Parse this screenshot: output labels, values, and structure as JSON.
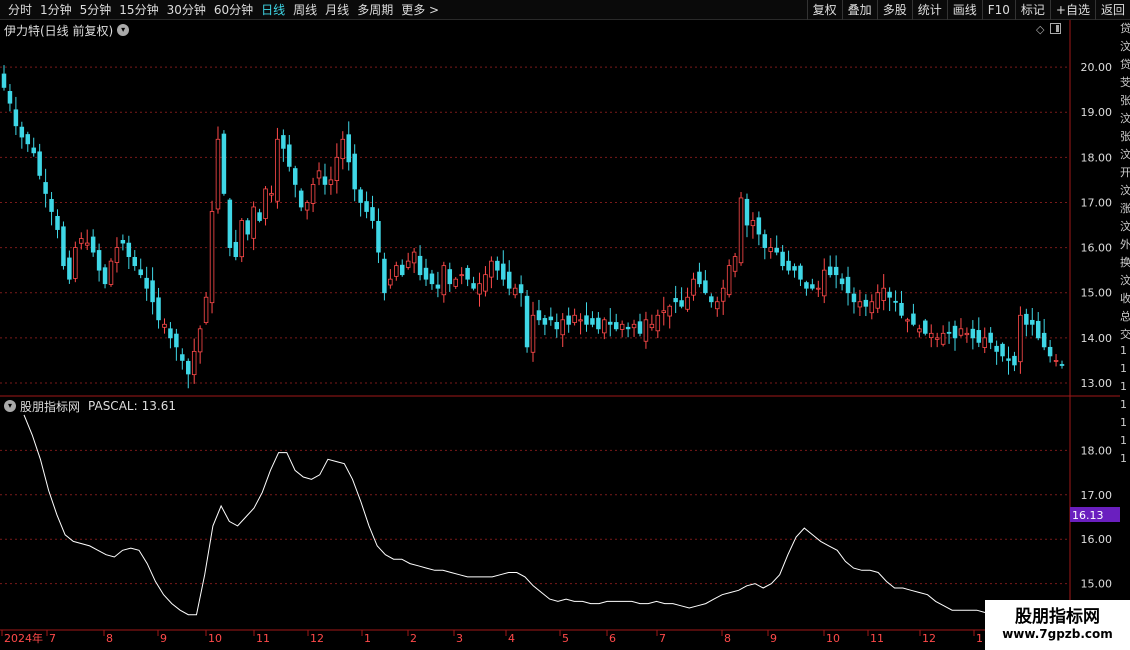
{
  "toolbar": {
    "period_tabs": [
      "分时",
      "1分钟",
      "5分钟",
      "15分钟",
      "30分钟",
      "60分钟",
      "日线",
      "周线",
      "月线",
      "多周期",
      "更多 >"
    ],
    "active_tab": "日线",
    "right_buttons": [
      "复权",
      "叠加",
      "多股",
      "统计",
      "画线",
      "F10",
      "标记",
      "+自选",
      "返回"
    ]
  },
  "main_chart": {
    "title": "伊力特(日线 前复权)",
    "price_ticks": [
      "20.00",
      "19.00",
      "18.00",
      "17.00",
      "16.00",
      "15.00",
      "14.00",
      "13.00"
    ]
  },
  "indicator": {
    "title": "股朋指标网",
    "label": "PASCAL:",
    "value": "13.61",
    "ticks": [
      "18.00",
      "17.00",
      "16.00",
      "15.00"
    ],
    "cursor_value": "16.13",
    "cursor_color": "#6a1fbf"
  },
  "date_axis": {
    "labels": [
      "2024年",
      "7",
      "8",
      "9",
      "10",
      "11",
      "12",
      "1",
      "2",
      "3",
      "4",
      "5",
      "6",
      "7",
      "8",
      "9",
      "10",
      "11",
      "12",
      "1"
    ]
  },
  "right_edge_chars": [
    "贷",
    "汶",
    "贷",
    "芠",
    "张",
    "汶",
    "张",
    "汶",
    "开",
    "汶",
    "涨",
    "汶",
    "外",
    "换",
    "汶",
    "收",
    "总",
    "交",
    "1",
    "1",
    "1",
    "1",
    "1",
    "1",
    "1"
  ],
  "watermark": {
    "title": "股朋指标网",
    "url": "www.7gpzb.com"
  },
  "colors": {
    "up": "#ff4a4a",
    "down": "#3fd7e6",
    "grid": "#7a1a1a",
    "axis": "#a01818",
    "line": "#ffffff"
  },
  "chart_data": [
    {
      "type": "candlestick",
      "title": "伊力特(日线 前复权)",
      "ylim": [
        12.8,
        20.6
      ],
      "y_ticks": [
        20,
        19,
        18,
        17,
        16,
        15,
        14,
        13
      ],
      "x_labels": [
        "2024年",
        "7",
        "8",
        "9",
        "10",
        "11",
        "12",
        "1",
        "2",
        "3",
        "4",
        "5",
        "6",
        "7",
        "8",
        "9",
        "10",
        "11",
        "12",
        "1"
      ],
      "close": [
        19.55,
        19.2,
        18.7,
        18.45,
        18.3,
        18.1,
        17.6,
        17.2,
        16.8,
        16.4,
        15.6,
        15.3,
        16.0,
        16.2,
        16.1,
        15.9,
        15.5,
        15.2,
        15.7,
        16.0,
        16.1,
        15.8,
        15.6,
        15.4,
        15.1,
        14.8,
        14.4,
        14.3,
        14.0,
        13.8,
        13.5,
        13.2,
        13.7,
        14.2,
        14.9,
        16.8,
        18.4,
        17.2,
        16.0,
        15.8,
        16.6,
        16.3,
        16.9,
        16.6,
        17.3,
        17.2,
        18.4,
        18.2,
        17.8,
        17.4,
        16.9,
        17.0,
        17.4,
        17.7,
        17.4,
        17.5,
        18.0,
        18.4,
        17.9,
        17.3,
        17.0,
        16.8,
        16.6,
        15.9,
        15.0,
        15.3,
        15.6,
        15.4,
        15.7,
        15.9,
        15.4,
        15.3,
        15.2,
        15.1,
        15.6,
        15.2,
        15.3,
        15.4,
        15.3,
        15.1,
        15.2,
        15.4,
        15.7,
        15.5,
        15.3,
        15.1,
        15.1,
        15.0,
        13.8,
        14.5,
        14.4,
        14.3,
        14.4,
        14.2,
        14.4,
        14.3,
        14.5,
        14.4,
        14.3,
        14.3,
        14.2,
        14.4,
        14.3,
        14.2,
        14.3,
        14.2,
        14.3,
        14.1,
        14.4,
        14.3,
        14.5,
        14.6,
        14.7,
        14.8,
        14.7,
        14.9,
        15.3,
        15.2,
        15.0,
        14.8,
        14.8,
        15.1,
        15.6,
        15.8,
        17.1,
        16.5,
        16.6,
        16.3,
        16.0,
        16.0,
        15.9,
        15.6,
        15.5,
        15.5,
        15.3,
        15.1,
        15.1,
        15.1,
        15.5,
        15.4,
        15.4,
        15.2,
        15.0,
        14.8,
        14.8,
        14.7,
        14.8,
        15.0,
        15.1,
        14.9,
        14.8,
        14.5,
        14.4,
        14.3,
        14.2,
        14.1,
        14.1,
        14.0,
        14.1,
        14.1,
        14.0,
        14.2,
        14.1,
        14.0,
        13.9,
        14.0,
        13.9,
        13.7,
        13.6,
        13.5,
        13.4,
        14.5,
        14.3,
        14.3,
        14.0,
        13.8,
        13.6,
        13.5,
        13.4
      ]
    },
    {
      "type": "line",
      "name": "PASCAL",
      "ylim": [
        14.0,
        19.0
      ],
      "y_ticks": [
        18,
        17,
        16,
        15
      ],
      "values": [
        18.8,
        18.35,
        17.8,
        17.1,
        16.55,
        16.1,
        15.95,
        15.9,
        15.85,
        15.75,
        15.65,
        15.6,
        15.75,
        15.8,
        15.75,
        15.45,
        15.05,
        14.75,
        14.55,
        14.4,
        14.3,
        14.3,
        15.2,
        16.3,
        16.75,
        16.4,
        16.3,
        16.5,
        16.7,
        17.05,
        17.55,
        17.95,
        17.95,
        17.55,
        17.4,
        17.35,
        17.45,
        17.8,
        17.75,
        17.7,
        17.35,
        16.85,
        16.3,
        15.85,
        15.65,
        15.55,
        15.55,
        15.45,
        15.4,
        15.35,
        15.3,
        15.3,
        15.25,
        15.2,
        15.15,
        15.15,
        15.15,
        15.15,
        15.2,
        15.25,
        15.25,
        15.15,
        14.95,
        14.8,
        14.65,
        14.6,
        14.65,
        14.6,
        14.6,
        14.55,
        14.55,
        14.6,
        14.6,
        14.6,
        14.6,
        14.55,
        14.55,
        14.6,
        14.55,
        14.55,
        14.5,
        14.45,
        14.5,
        14.55,
        14.65,
        14.75,
        14.8,
        14.85,
        14.95,
        15.0,
        14.9,
        15.0,
        15.2,
        15.65,
        16.05,
        16.25,
        16.1,
        15.95,
        15.85,
        15.75,
        15.5,
        15.35,
        15.3,
        15.3,
        15.25,
        15.05,
        14.9,
        14.9,
        14.85,
        14.8,
        14.75,
        14.6,
        14.5,
        14.4,
        14.4,
        14.4,
        14.4,
        14.35
      ]
    }
  ]
}
